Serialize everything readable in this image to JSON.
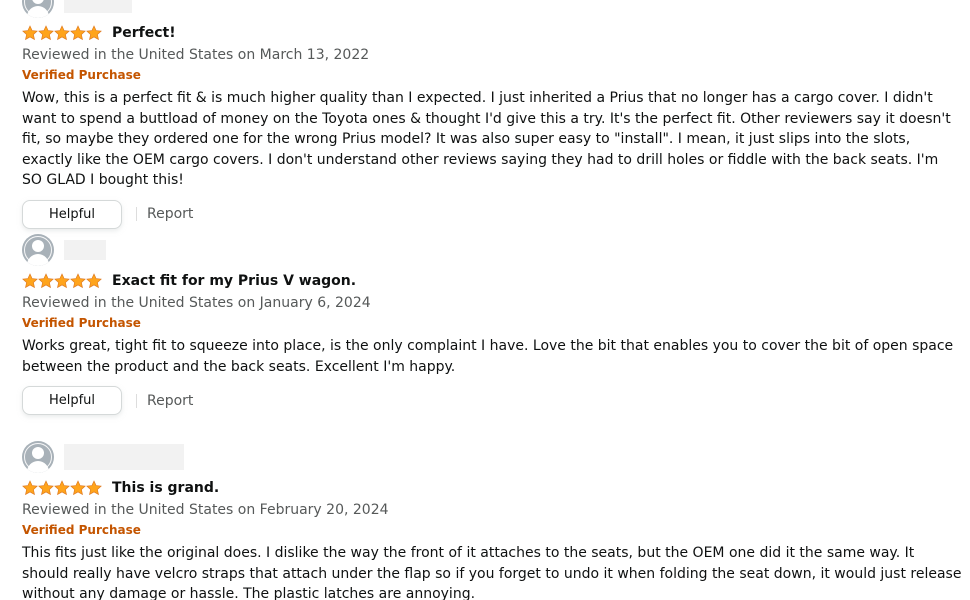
{
  "reviews": [
    {
      "rating": 5,
      "title": "Perfect!",
      "meta": "Reviewed in the United States on March 13, 2022",
      "badge": "Verified Purchase",
      "body": "Wow, this is a perfect fit & is much higher quality than I expected. I just inherited a Prius that no longer has a cargo cover. I didn't want to spend a buttload of money on the Toyota ones & thought I'd give this a try. It's the perfect fit. Other reviewers say it doesn't fit, so maybe they ordered one for the wrong Prius model? It was also super easy to \"install\". I mean, it just slips into the slots, exactly like the OEM cargo covers. I don't understand other reviews saying they had to drill holes or fiddle with the back seats. I'm SO GLAD I bought this!",
      "helpful_label": "Helpful",
      "report_label": "Report"
    },
    {
      "rating": 5,
      "title": "Exact fit for my Prius V wagon.",
      "meta": "Reviewed in the United States on January 6, 2024",
      "badge": "Verified Purchase",
      "body": "Works great, tight fit to squeeze into place, is the only complaint I have. Love the bit that enables you to cover the bit of open space between the product and the back seats. Excellent I'm happy.",
      "helpful_label": "Helpful",
      "report_label": "Report"
    },
    {
      "rating": 5,
      "title": "This is grand.",
      "meta": "Reviewed in the United States on February 20, 2024",
      "badge": "Verified Purchase",
      "body": "This fits just like the original does. I dislike the way the front of it attaches to the seats, but the OEM one did it the same way. It should really have velcro straps that attach under the flap so if you forget to undo it when folding the seat down, it would just release without any damage or hassle. The plastic latches are annoying."
    }
  ],
  "colors": {
    "star": "#ffa41c",
    "verified": "#c45500",
    "meta": "#565959",
    "text": "#0f1111"
  },
  "icons": {
    "avatar": "user-avatar-icon",
    "star": "star-icon"
  }
}
